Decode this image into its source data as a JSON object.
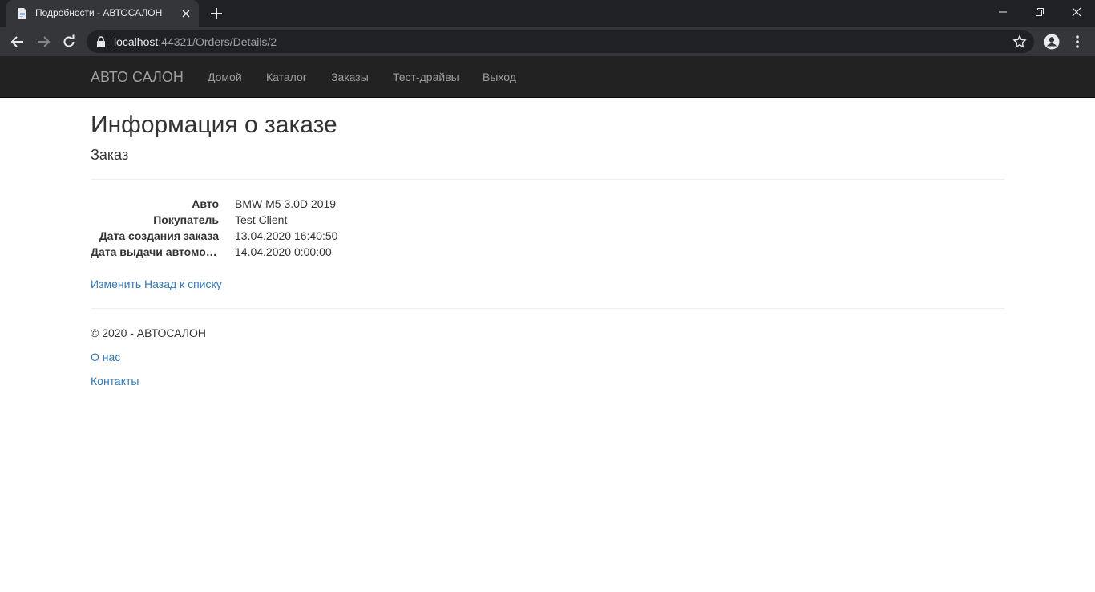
{
  "browser": {
    "tab_title": "Подробности - АВТОСАЛОН",
    "url_host": "localhost",
    "url_rest": ":44321/Orders/Details/2"
  },
  "navbar": {
    "brand": "АВТО САЛОН",
    "items": [
      {
        "label": "Домой"
      },
      {
        "label": "Каталог"
      },
      {
        "label": "Заказы"
      },
      {
        "label": "Тест-драйвы"
      },
      {
        "label": "Выход"
      }
    ]
  },
  "main": {
    "title": "Информация о заказе",
    "subtitle": "Заказ",
    "details": [
      {
        "label": "Авто",
        "value": "BMW M5 3.0D 2019"
      },
      {
        "label": "Покупатель",
        "value": "Test Client"
      },
      {
        "label": "Дата создания заказа",
        "value": "13.04.2020 16:40:50"
      },
      {
        "label": "Дата выдачи автомобиля",
        "value": "14.04.2020 0:00:00"
      }
    ],
    "edit_link": "Изменить",
    "back_link": "Назад к списку"
  },
  "footer": {
    "copyright": "© 2020 - АВТОСАЛОН",
    "about": "О нас",
    "contacts": "Контакты"
  },
  "colors": {
    "navbar_bg": "#222222",
    "link": "#337ab7",
    "chrome_bg": "#202124"
  }
}
